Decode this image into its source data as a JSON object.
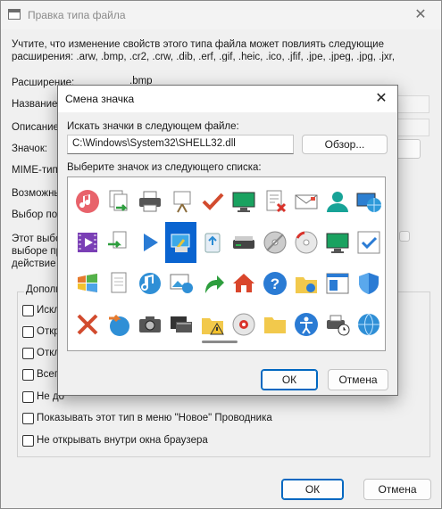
{
  "window": {
    "title": "Правка типа файла",
    "close_glyph": "✕",
    "warning_line1": "Учтите, что изменение свойств этого типа файла может повлиять следующие",
    "warning_line2": "расширения: .arw, .bmp, .cr2, .crw, .dib, .erf, .gif, .heic, .ico, .jfif, .jpe, .jpeg, .jpg, .jxr,"
  },
  "fields": {
    "extension_label": "Расширение:",
    "extension_value": ".bmp",
    "name_label": "Название т",
    "description_label": "Описание:",
    "icon_label": "Значок:",
    "mime_label": "MIME-тип:",
    "possible_label": "Возможны",
    "choice_label": "Выбор пол",
    "info_line1": "Этот выбо",
    "info_line2": "выборе пр",
    "info_line3": "действие"
  },
  "group": {
    "title": "Дополни",
    "checkboxes": [
      {
        "label": "Искл",
        "checked": false
      },
      {
        "label": "Откр",
        "checked": false
      },
      {
        "label": "Откл",
        "checked": false
      },
      {
        "label": "Всегд",
        "checked": false
      },
      {
        "label": "Не до",
        "checked": false
      },
      {
        "label": "Показывать этот тип в меню \"Новое\" Проводника",
        "checked": false
      },
      {
        "label": "Не открывать внутри окна браузера",
        "checked": false
      }
    ]
  },
  "buttons": {
    "ok": "ОК",
    "cancel": "Отмена"
  },
  "dialog": {
    "title": "Смена значка",
    "close_glyph": "✕",
    "search_label": "Искать значки в следующем файле:",
    "path_value": "C:\\Windows\\System32\\SHELL32.dll",
    "browse_button": "Обзор...",
    "list_label": "Выберите значок из следующего списка:",
    "ok": "ОК",
    "cancel": "Отмена",
    "selected_index": 13,
    "icons": [
      "music-icon",
      "copy-to-icon",
      "printer-icon",
      "presentation-icon",
      "checkmark-icon",
      "monitor-icon",
      "delete-doc-icon",
      "envelope-icon",
      "user-icon",
      "network-globe-icon",
      "video-icon",
      "move-to-icon",
      "play-icon",
      "display-settings-icon",
      "recycle-icon",
      "scanner-icon",
      "dvd-icon",
      "cd-icon",
      "monitor-icon",
      "checkbox-icon",
      "windows-logo-icon",
      "document-icon",
      "music-globe-icon",
      "picture-globe-icon",
      "green-arrow-icon",
      "home-network-icon",
      "help-icon",
      "shared-folder-icon",
      "folder-window-icon",
      "shield-icon",
      "red-x-icon",
      "backup-globe-icon",
      "camera-icon",
      "film-icon",
      "folder-warning-icon",
      "disc-red-icon",
      "folder-icon",
      "accessibility-icon",
      "printer-clock-icon",
      "globe-icon"
    ]
  }
}
